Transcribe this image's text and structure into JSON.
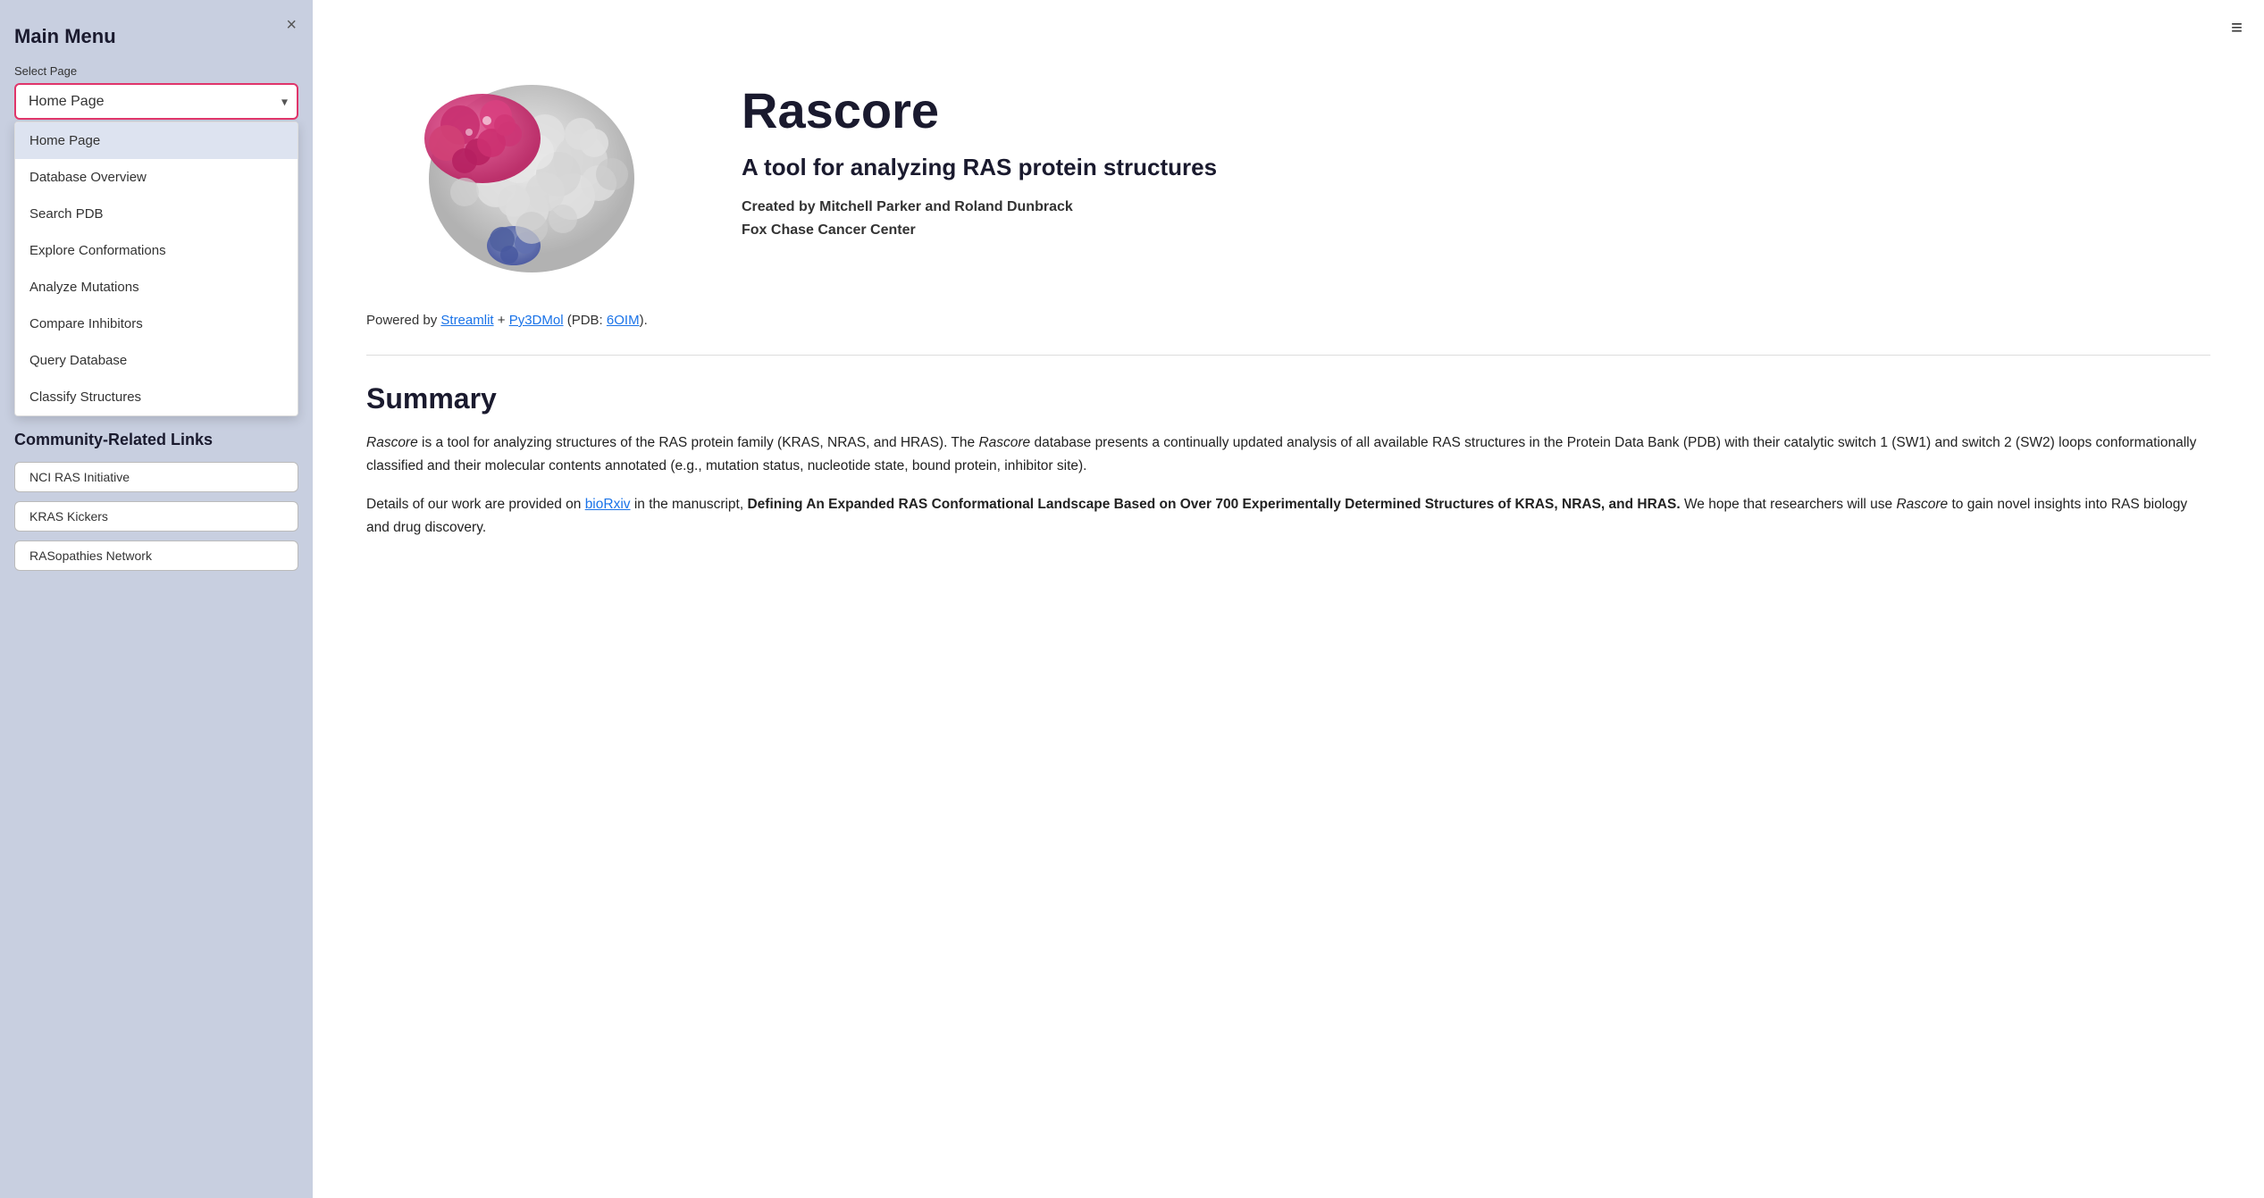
{
  "sidebar": {
    "title": "Main Menu",
    "select_label": "Select Page",
    "current_page": "Home Page",
    "close_icon": "×",
    "dropdown_items": [
      {
        "label": "Home Page",
        "active": true
      },
      {
        "label": "Database Overview",
        "active": false
      },
      {
        "label": "Search PDB",
        "active": false
      },
      {
        "label": "Explore Conformations",
        "active": false
      },
      {
        "label": "Analyze Mutations",
        "active": false
      },
      {
        "label": "Compare Inhibitors",
        "active": false
      },
      {
        "label": "Query Database",
        "active": false
      },
      {
        "label": "Classify Structures",
        "active": false
      }
    ],
    "community_title": "Community-Related Links",
    "community_links": [
      {
        "label": "NCI RAS Initiative"
      },
      {
        "label": "KRAS Kickers"
      },
      {
        "label": "RASopathies Network"
      }
    ]
  },
  "header": {
    "hamburger_icon": "≡"
  },
  "hero": {
    "app_title": "Rascore",
    "app_subtitle": "A tool for analyzing RAS protein structures",
    "creator_label": "Created by Mitchell Parker and Roland Dunbrack",
    "institution_label": "Fox Chase Cancer Center",
    "powered_by_prefix": "Powered by ",
    "powered_by_streamlit": "Streamlit",
    "powered_by_plus": " + ",
    "powered_by_py3dmol": "Py3DMol",
    "powered_by_pdb_prefix": " (PDB: ",
    "powered_by_pdb": "6OIM",
    "powered_by_suffix": ")."
  },
  "summary": {
    "title": "Summary",
    "paragraph1_start": "",
    "paragraph1": "Rascore is a tool for analyzing structures of the RAS protein family (KRAS, NRAS, and HRAS). The Rascore database presents a continually updated analysis of all available RAS structures in the Protein Data Bank (PDB) with their catalytic switch 1 (SW1) and switch 2 (SW2) loops conformationally classified and their molecular contents annotated (e.g., mutation status, nucleotide state, bound protein, inhibitor site).",
    "paragraph2_start": "Details of our work are provided on ",
    "paragraph2_link": "bioRxiv",
    "paragraph2_middle": " in the manuscript, ",
    "paragraph2_bold": "Defining An Expanded RAS Conformational Landscape Based on Over 700 Experimentally Determined Structures of KRAS, NRAS, and HRAS.",
    "paragraph2_end": " We hope that researchers will use Rascore to gain novel insights into RAS biology and drug discovery."
  }
}
